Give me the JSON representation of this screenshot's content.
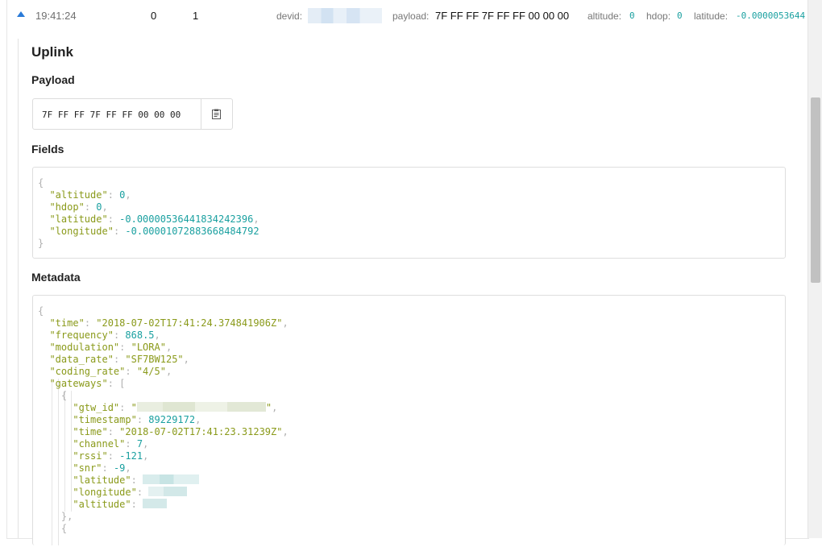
{
  "row": {
    "time": "19:41:24",
    "count_a": "0",
    "count_b": "1",
    "devid_label": "devid:",
    "payload_label": "payload:",
    "payload_value": "7F FF FF 7F FF FF 00 00 00",
    "altitude_label": "altitude:",
    "altitude_value": "0",
    "hdop_label": "hdop:",
    "hdop_value": "0",
    "latitude_label": "latitude:",
    "latitude_value": "-0.0000053644"
  },
  "detail": {
    "title": "Uplink",
    "payload_heading": "Payload",
    "payload_hex": "7F FF FF 7F FF FF 00 00 00",
    "fields_heading": "Fields",
    "metadata_heading": "Metadata"
  },
  "fields": {
    "altitude": "0",
    "hdop": "0",
    "latitude": "-0.00000536441834242396",
    "longitude": "-0.00001072883668484792"
  },
  "metadata": {
    "time": "\"2018-07-02T17:41:24.374841906Z\"",
    "frequency": "868.5",
    "modulation": "\"LORA\"",
    "data_rate": "\"SF7BW125\"",
    "coding_rate": "\"4/5\"",
    "gateway": {
      "timestamp": "89229172",
      "time": "\"2018-07-02T17:41:23.31239Z\"",
      "channel": "7",
      "rssi": "-121",
      "snr": "-9"
    }
  },
  "icons": {
    "collapse": "caret-up-icon",
    "copy": "clipboard-icon"
  },
  "colors": {
    "key_string": "#8a9a1a",
    "number": "#1aa0a0",
    "accent": "#2a7bd8"
  }
}
